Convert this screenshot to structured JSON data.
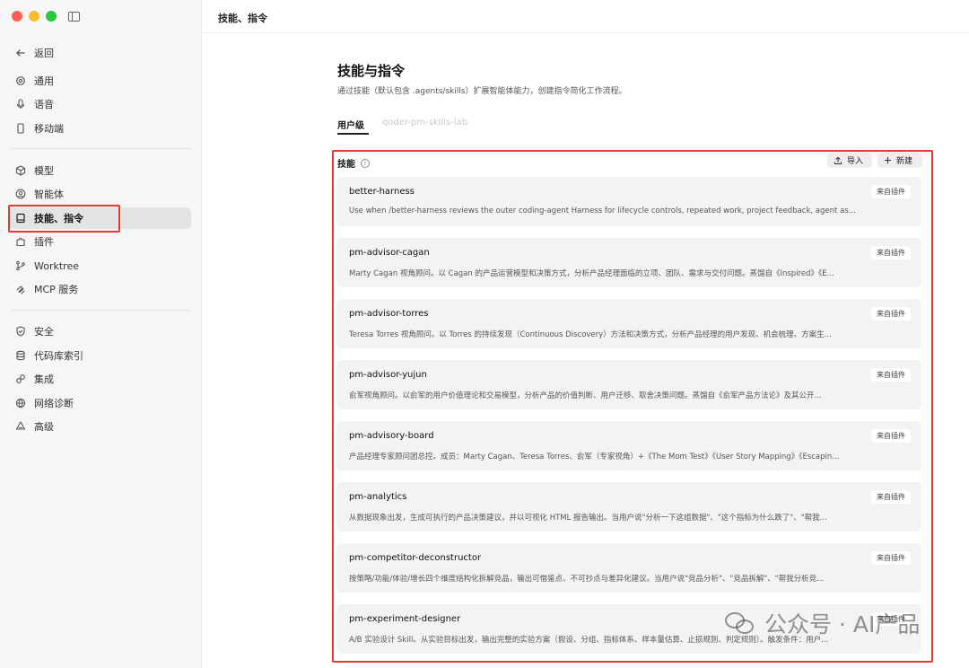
{
  "window": {
    "title": "技能、指令"
  },
  "sidebar": {
    "items": [
      {
        "label": "返回",
        "icon": "arrow-left-icon"
      },
      {
        "label": "通用",
        "icon": "gear-icon"
      },
      {
        "label": "语音",
        "icon": "microphone-icon"
      },
      {
        "label": "移动端",
        "icon": "phone-icon"
      },
      {
        "label": "模型",
        "icon": "cube-icon"
      },
      {
        "label": "智能体",
        "icon": "agent-icon"
      },
      {
        "label": "技能、指令",
        "icon": "book-icon",
        "active": true
      },
      {
        "label": "插件",
        "icon": "puzzle-icon"
      },
      {
        "label": "Worktree",
        "icon": "branch-icon"
      },
      {
        "label": "MCP 服务",
        "icon": "mcp-icon"
      },
      {
        "label": "安全",
        "icon": "shield-icon"
      },
      {
        "label": "代码库索引",
        "icon": "database-icon"
      },
      {
        "label": "集成",
        "icon": "link-icon"
      },
      {
        "label": "网络诊断",
        "icon": "globe-icon"
      },
      {
        "label": "高级",
        "icon": "advanced-icon"
      }
    ]
  },
  "main": {
    "title": "技能与指令",
    "description": "通过技能（默认包含 .agents/skills）扩展智能体能力，创建指令简化工作流程。",
    "tabs": [
      {
        "label": "用户级",
        "active": true
      },
      {
        "label": "qoder-pm-skills-lab",
        "active": false
      }
    ],
    "skills_label": "技能",
    "import_label": "导入",
    "new_label": "新建",
    "skills": [
      {
        "name": "better-harness",
        "badge": "来自插件",
        "desc": "Use when /better-harness reviews the outer coding-agent Harness for lifecycle controls, repeated work, project feedback, agent as..."
      },
      {
        "name": "pm-advisor-cagan",
        "badge": "来自插件",
        "desc": "Marty Cagan 视角顾问。以 Cagan 的产品运营模型和决策方式，分析产品经理面临的立项、团队、需求与交付问题。蒸馏自《Inspired》《E..."
      },
      {
        "name": "pm-advisor-torres",
        "badge": "来自插件",
        "desc": "Teresa Torres 视角顾问。以 Torres 的持续发现（Continuous Discovery）方法和决策方式，分析产品经理的用户发现、机会梳理、方案生..."
      },
      {
        "name": "pm-advisor-yujun",
        "badge": "来自插件",
        "desc": "俞军视角顾问。以俞军的用户价值理论和交易模型，分析产品的价值判断、用户迁移、取舍决策问题。蒸馏自《俞军产品方法论》及其公开..."
      },
      {
        "name": "pm-advisory-board",
        "badge": "来自插件",
        "desc": "产品经理专家顾问团总控。成员：Marty Cagan、Teresa Torres、俞军（专家视角）+《The Mom Test》《User Story Mapping》《Escapin..."
      },
      {
        "name": "pm-analytics",
        "badge": "来自插件",
        "desc": "从数据现象出发，生成可执行的产品决策建议，并以可视化 HTML 报告输出。当用户说\"分析一下这组数据\"、\"这个指标为什么跌了\"、\"帮我..."
      },
      {
        "name": "pm-competitor-deconstructor",
        "badge": "来自插件",
        "desc": "按策略/功能/体验/增长四个维度结构化拆解竞品，输出可借鉴点、不可抄点与差异化建议。当用户说\"竞品分析\"、\"竞品拆解\"、\"帮我分析竞..."
      },
      {
        "name": "pm-experiment-designer",
        "badge": "来自插件",
        "desc": "A/B 实验设计 Skill。从实验目标出发，输出完整的实验方案（假设、分组、指标体系、样本量估算、止损规则、判定规则）。触发条件：用户..."
      }
    ]
  },
  "watermark": {
    "text": "公众号 · AI产品"
  }
}
